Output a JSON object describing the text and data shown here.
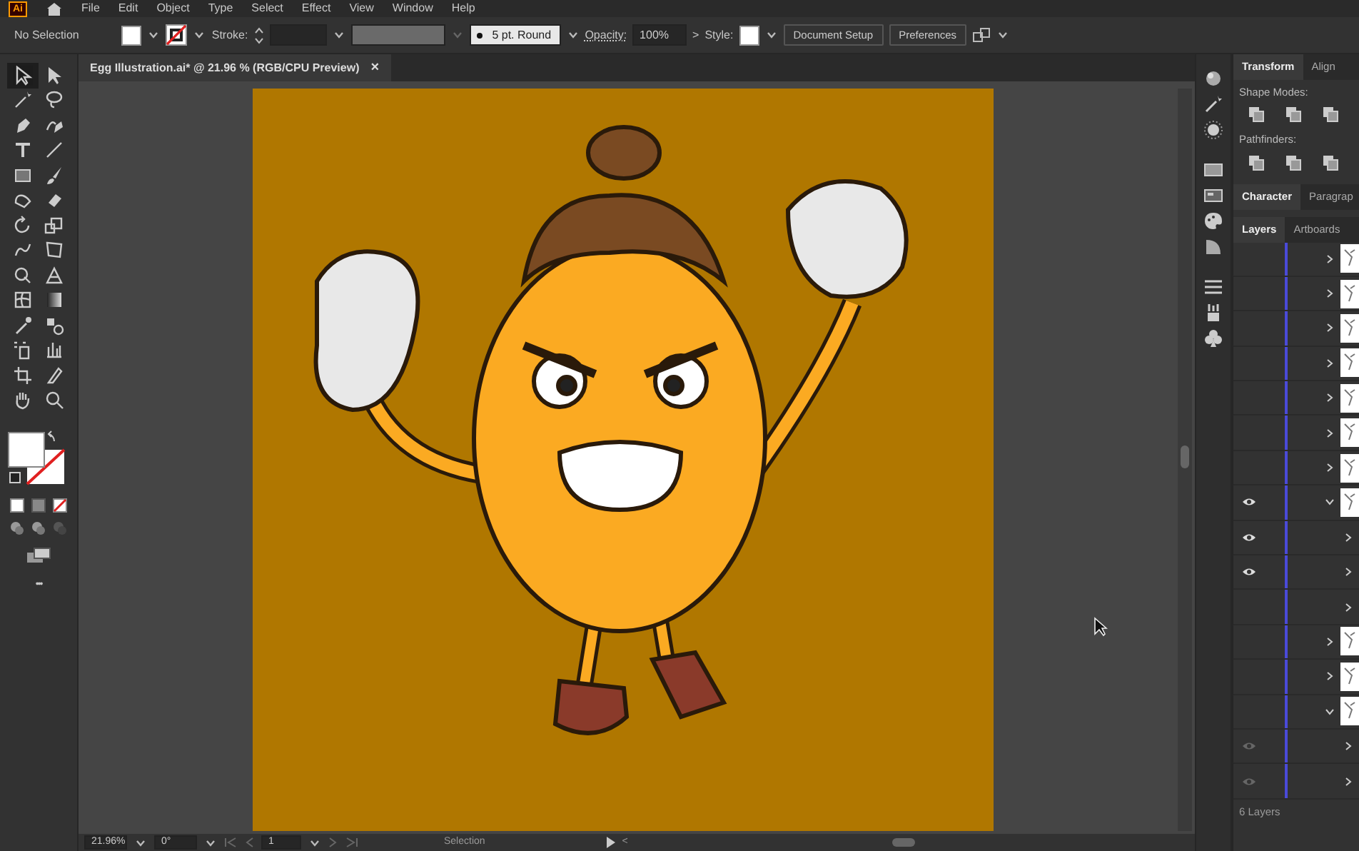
{
  "menu_bar": {
    "app_logo": "Ai",
    "items": [
      "File",
      "Edit",
      "Object",
      "Type",
      "Select",
      "Effect",
      "View",
      "Window",
      "Help"
    ]
  },
  "control_bar": {
    "selection_label": "No Selection",
    "stroke_label": "Stroke:",
    "brush": "5 pt. Round",
    "opacity_label": "Opacity:",
    "opacity": "100%",
    "more": ">",
    "style_label": "Style:",
    "buttons": [
      "Document Setup",
      "Preferences"
    ]
  },
  "document_tab": {
    "title": "Egg Illustration.ai* @ 21.96 % (RGB/CPU Preview)",
    "close": "×",
    "selected": true
  },
  "tools": [
    {
      "kind": "selection",
      "selected": true
    },
    {
      "kind": "direct-selection",
      "selected": false
    },
    {
      "kind": "magic-wand",
      "selected": false
    },
    {
      "kind": "lasso",
      "selected": false
    },
    {
      "kind": "pen",
      "selected": false
    },
    {
      "kind": "curvature",
      "selected": false
    },
    {
      "kind": "type",
      "selected": false
    },
    {
      "kind": "line",
      "selected": false
    },
    {
      "kind": "rectangle",
      "selected": false
    },
    {
      "kind": "paintbrush",
      "selected": false
    },
    {
      "kind": "shaper",
      "selected": false
    },
    {
      "kind": "eraser",
      "selected": false
    },
    {
      "kind": "rotate",
      "selected": false
    },
    {
      "kind": "scale",
      "selected": false
    },
    {
      "kind": "warp",
      "selected": false
    },
    {
      "kind": "free-transform",
      "selected": false
    },
    {
      "kind": "shape-builder",
      "selected": false
    },
    {
      "kind": "perspective",
      "selected": false
    },
    {
      "kind": "mesh",
      "selected": false
    },
    {
      "kind": "gradient",
      "selected": false
    },
    {
      "kind": "eyedropper",
      "selected": false
    },
    {
      "kind": "blend",
      "selected": false
    },
    {
      "kind": "symbol-sprayer",
      "selected": false
    },
    {
      "kind": "graph",
      "selected": false
    },
    {
      "kind": "artboard",
      "selected": false
    },
    {
      "kind": "slice",
      "selected": false
    },
    {
      "kind": "hand",
      "selected": false
    },
    {
      "kind": "zoom",
      "selected": false
    }
  ],
  "toolbar_more": "•••",
  "panels": {
    "transform_tabs": [
      {
        "label": "Transform",
        "selected": true
      },
      {
        "label": "Align",
        "selected": false
      }
    ],
    "shape_modes_label": "Shape Modes:",
    "pathfinders_label": "Pathfinders:",
    "type_tabs": [
      {
        "label": "Character",
        "selected": true
      },
      {
        "label": "Paragrap",
        "selected": false
      }
    ],
    "layer_tabs": [
      {
        "label": "Layers",
        "selected": true
      },
      {
        "label": "Artboards",
        "selected": false
      }
    ],
    "layers": [
      {
        "visible": false,
        "expanded": false,
        "thumbnail": true
      },
      {
        "visible": false,
        "expanded": false,
        "thumbnail": true
      },
      {
        "visible": false,
        "expanded": false,
        "thumbnail": true
      },
      {
        "visible": false,
        "expanded": false,
        "thumbnail": true
      },
      {
        "visible": false,
        "expanded": false,
        "thumbnail": true
      },
      {
        "visible": false,
        "expanded": false,
        "thumbnail": true
      },
      {
        "visible": false,
        "expanded": false,
        "thumbnail": true
      },
      {
        "visible": true,
        "dimmed": false,
        "expanded": true,
        "thumbnail": true
      },
      {
        "visible": true,
        "dimmed": false,
        "expanded": false,
        "thumbnail": false
      },
      {
        "visible": true,
        "dimmed": false,
        "expanded": false,
        "thumbnail": false
      },
      {
        "visible": false,
        "expanded": false,
        "thumbnail": false
      },
      {
        "visible": false,
        "expanded": false,
        "thumbnail": true
      },
      {
        "visible": false,
        "expanded": false,
        "thumbnail": true
      },
      {
        "visible": false,
        "expanded": true,
        "thumbnail": true
      },
      {
        "visible": true,
        "dimmed": true,
        "expanded": false,
        "thumbnail": false
      },
      {
        "visible": true,
        "dimmed": true,
        "expanded": false,
        "thumbnail": false
      }
    ],
    "layer_count": "6 Layers"
  },
  "status_bar": {
    "zoom": "21.96%",
    "rotation": "0°",
    "artboard": "1",
    "tool": "Selection",
    "back": "<"
  }
}
